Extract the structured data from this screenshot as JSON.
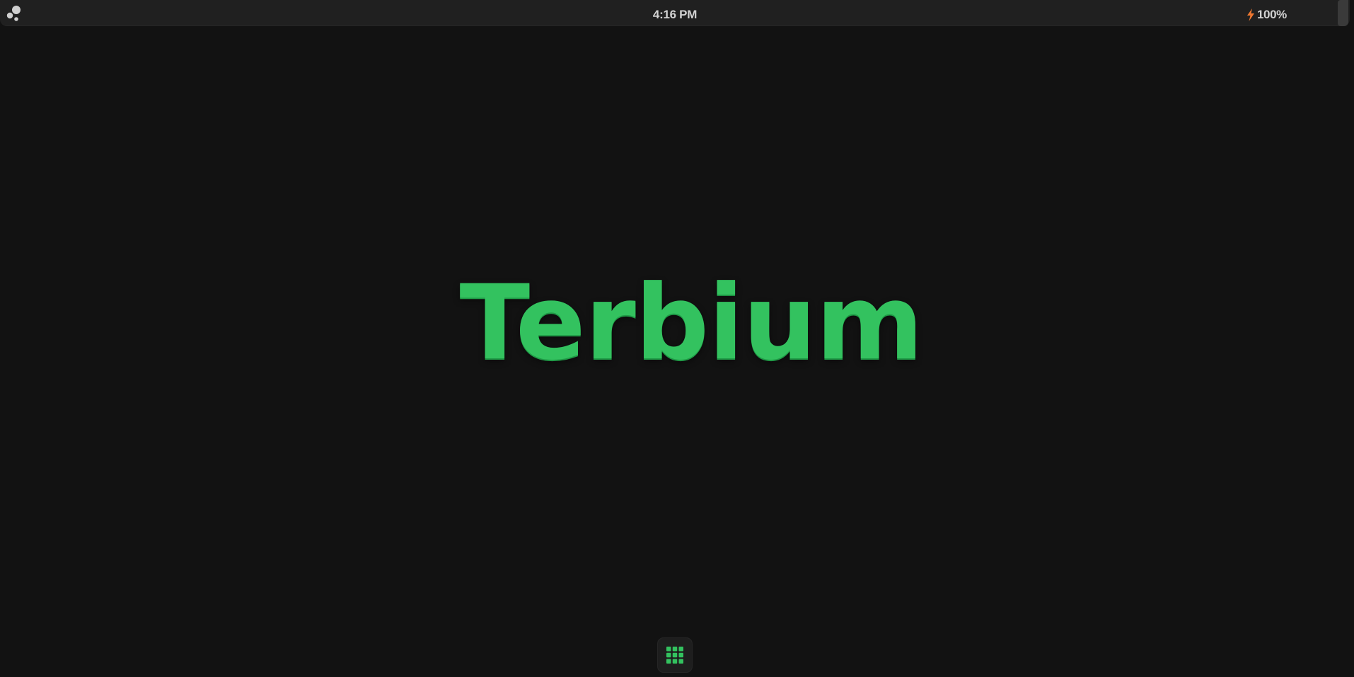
{
  "topbar": {
    "launcher_icon": "terbium-dots-icon",
    "clock": "4:16 PM",
    "battery": {
      "icon": "charging-bolt-icon",
      "percent": "100%",
      "bolt_color": "#f07830"
    }
  },
  "desktop": {
    "logo_text": "Terbium",
    "logo_color": "#33c25f"
  },
  "dock": {
    "app_grid_icon": "app-grid-icon",
    "icon_color": "#33c25f"
  }
}
